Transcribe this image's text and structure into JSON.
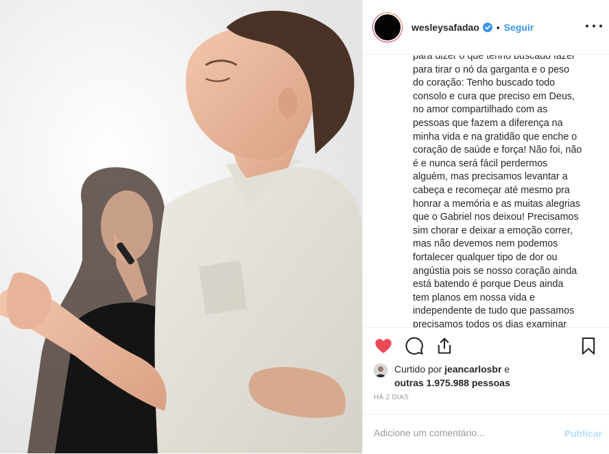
{
  "header": {
    "username": "wesleysafadao",
    "separator": "•",
    "follow_label": "Seguir",
    "verified_icon": "verified-badge-icon",
    "more_icon": "more-options-icon"
  },
  "caption": {
    "text": "para dizer o que tenho buscado fazer\npara tirar o nó da garganta e o peso\ndo coração: Tenho buscado todo\nconsolo e cura que preciso em Deus,\nno amor compartilhado com as\npessoas que fazem a diferença na\nminha vida e na gratidão que enche o\ncoração de saúde e força! Não foi, não\né e nunca será fácil perdermos\nalguém, mas precisamos levantar a\ncabeça e recomeçar até mesmo pra\nhonrar a memória e as muitas alegrias\nque o Gabriel nos deixou! Precisamos\nsim chorar e deixar a emoção correr,\nmas não devemos nem podemos\nfortalecer qualquer tipo de dor ou\nangústia pois se nosso coração ainda\nestá batendo é porque Deus ainda\ntem planos em nossa vida e\nindependente de tudo que passamos\nprecisamos todos os dias examinar"
  },
  "actions": {
    "like_icon": "heart-filled-icon",
    "comment_icon": "comment-icon",
    "share_icon": "share-icon",
    "save_icon": "bookmark-icon",
    "like_color": "#ed4956"
  },
  "likes": {
    "prefix": "Curtido por",
    "user": "jeancarlosbr",
    "conjunction": "e",
    "others": "outras 1.975.988 pessoas"
  },
  "age": "HÁ 2 DIAS",
  "comment": {
    "placeholder": "Adicione um comentário...",
    "publish_label": "Publicar"
  },
  "colors": {
    "link": "#3897f0",
    "publish_disabled": "#b2dffc",
    "border": "#efefef"
  }
}
